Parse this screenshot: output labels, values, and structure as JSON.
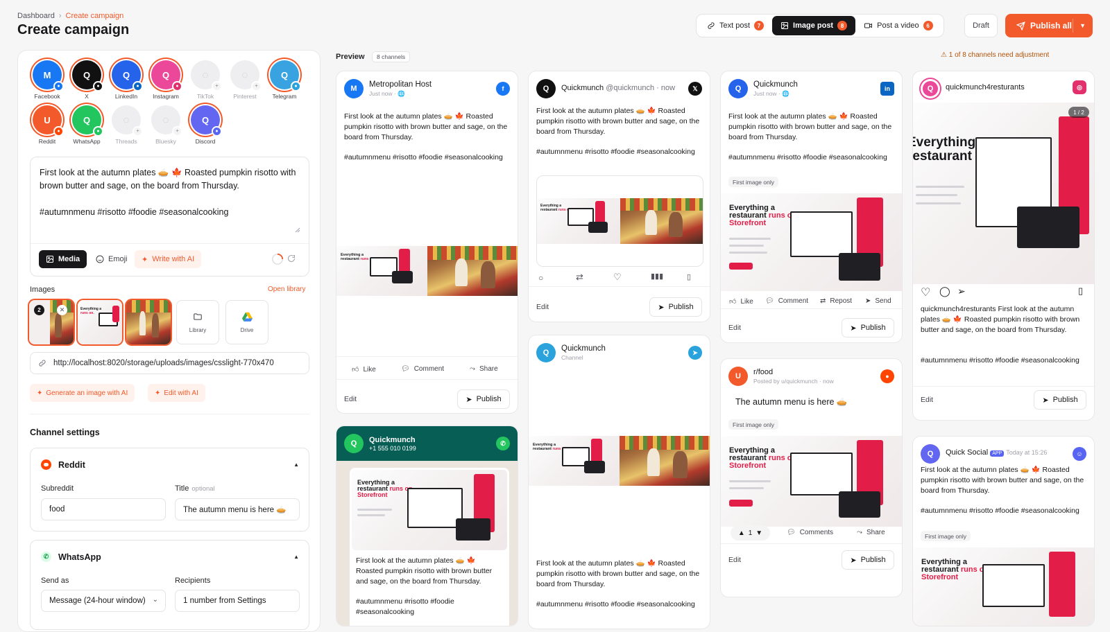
{
  "breadcrumb": {
    "root": "Dashboard",
    "current": "Create campaign"
  },
  "page_title": "Create campaign",
  "post_types": [
    {
      "label": "Text post",
      "count": "7"
    },
    {
      "label": "Image post",
      "count": "8"
    },
    {
      "label": "Post a video",
      "count": "6"
    }
  ],
  "draft_label": "Draft",
  "publish_all_label": "Publish all",
  "channels": [
    {
      "label": "Facebook",
      "letter": "M",
      "color": "#1877f2",
      "badge": "#1877f2"
    },
    {
      "label": "X",
      "letter": "Q",
      "color": "#111111",
      "badge": "#111111"
    },
    {
      "label": "LinkedIn",
      "letter": "Q",
      "color": "#2563eb",
      "badge": "#0a66c2"
    },
    {
      "label": "Instagram",
      "letter": "Q",
      "color": "#ec4899",
      "badge": "#e1306c"
    },
    {
      "label": "TikTok",
      "letter": "",
      "color": "",
      "badge": ""
    },
    {
      "label": "Pinterest",
      "letter": "",
      "color": "",
      "badge": ""
    },
    {
      "label": "Telegram",
      "letter": "Q",
      "color": "#38a3e0",
      "badge": "#2aa3dd"
    },
    {
      "label": "Reddit",
      "letter": "U",
      "color": "#f25a2b",
      "badge": "#ff4500"
    },
    {
      "label": "WhatsApp",
      "letter": "Q",
      "color": "#22c55e",
      "badge": "#22c55e"
    },
    {
      "label": "Threads",
      "letter": "",
      "color": "",
      "badge": ""
    },
    {
      "label": "Bluesky",
      "letter": "",
      "color": "",
      "badge": ""
    },
    {
      "label": "Discord",
      "letter": "Q",
      "color": "#6366f1",
      "badge": "#5865f2"
    }
  ],
  "composer": {
    "text": "First look at the autumn plates 🥧 🍁 Roasted pumpkin risotto with brown butter and sage, on the board from Thursday.\n\n#autumnmenu #risotto #foodie #seasonalcooking",
    "media_label": "Media",
    "emoji_label": "Emoji",
    "write_ai_label": "Write with AI"
  },
  "images": {
    "label": "Images",
    "open_library": "Open library",
    "selected_count": "2",
    "library_label": "Library",
    "drive_label": "Drive",
    "url": "http://localhost:8020/storage/uploads/images/csslight-770x470",
    "generate_label": "Generate an image with AI",
    "edit_label": "Edit with AI"
  },
  "channel_settings": {
    "title": "Channel settings",
    "reddit": {
      "name": "Reddit",
      "subreddit_label": "Subreddit",
      "title_label": "Title",
      "title_optional": "optional",
      "subreddit": "food",
      "title": "The autumn menu is here 🥧"
    },
    "whatsapp": {
      "name": "WhatsApp",
      "send_as_label": "Send as",
      "recipients_label": "Recipients",
      "send_as": "Message (24-hour window)",
      "recipients": "1 number from Settings"
    }
  },
  "preview": {
    "label": "Preview",
    "channels_badge": "8 channels",
    "warning": "1 of 8 channels need adjustment",
    "post_text": "First look at the autumn plates 🥧 🍁 Roasted pumpkin risotto with brown butter and sage, on the board from Thursday.",
    "hashtags": "#autumnmenu #risotto #foodie #seasonalcooking",
    "edit_label": "Edit",
    "publish_label": "Publish",
    "first_image_only": "First image only",
    "image_counter": "1 / 2",
    "facebook": {
      "name": "Metropolitan Host",
      "sub": "Just now · 🌐",
      "like": "Like",
      "comment": "Comment",
      "share": "Share"
    },
    "x": {
      "name": "Quickmunch",
      "handle": "@quickmunch · now"
    },
    "telegram": {
      "name": "Quickmunch",
      "sub": "Channel"
    },
    "whatsapp": {
      "name": "Quickmunch",
      "phone": "+1 555 010 0199"
    },
    "linkedin": {
      "name": "Quickmunch",
      "sub": "Just now · 🌐",
      "like": "Like",
      "comment": "Comment",
      "repost": "Repost",
      "send": "Send"
    },
    "reddit": {
      "name": "r/food",
      "sub": "Posted by u/quickmunch · now",
      "title": "The autumn menu is here 🥧",
      "votes": "1",
      "comments": "Comments",
      "share": "Share"
    },
    "instagram": {
      "name": "quickmunch4resturants",
      "caption": "quickmunch4resturants First look at the autumn plates 🥧 🍁 Roasted pumpkin risotto with brown butter and sage, on the board from Thursday."
    },
    "discord": {
      "name": "Quick Social",
      "app": "APP",
      "time": "Today at 15:26"
    },
    "img_headline": [
      "Everything a",
      "restaurant",
      "runs on.",
      "Storefront"
    ]
  }
}
